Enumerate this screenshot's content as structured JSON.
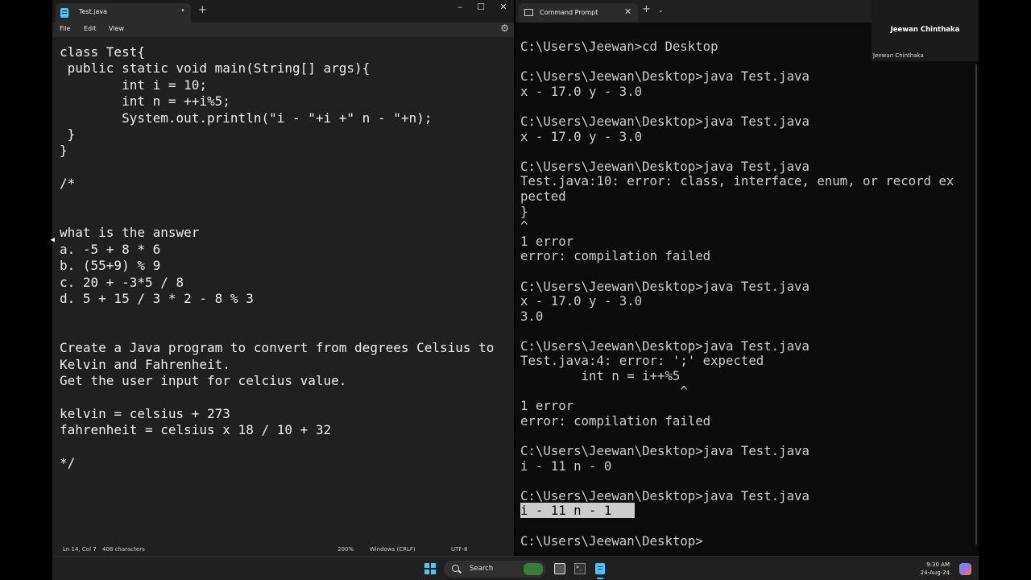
{
  "notepad": {
    "tab_title": "Test.java",
    "tab_dot": "•",
    "new_tab": "+",
    "window_controls": {
      "minimize": "–",
      "maximize": "☐",
      "close": "✕"
    },
    "menu": [
      "File",
      "Edit",
      "View"
    ],
    "settings_icon": "⚙",
    "editor_text": "class Test{\n public static void main(String[] args){\n        int i = 10;\n        int n = ++i%5;\n        System.out.println(\"i - \"+i +\" n - \"+n);\n }\n}\n\n/*\n\n\nwhat is the answer\na. -5 + 8 * 6\nb. (55+9) % 9\nc. 20 + -3*5 / 8\nd. 5 + 15 / 3 * 2 - 8 % 3\n\n\nCreate a Java program to convert from degrees Celsius to\nKelvin and Fahrenheit.\nGet the user input for celcius value.\n\nkelvin = celsius + 273\nfahrenheit = celsius x 18 / 10 + 32\n\n*/",
    "status": {
      "position": "Ln 14, Col 7",
      "characters": "408 characters",
      "zoom": "200%",
      "line_ending": "Windows (CRLF)",
      "encoding": "UTF-8"
    }
  },
  "cmd": {
    "tab_title": "Command Prompt",
    "close": "✕",
    "new_tab": "+",
    "dropdown": "⌄",
    "output_before_selection": "C:\\Users\\Jeewan>cd Desktop\n\nC:\\Users\\Jeewan\\Desktop>java Test.java\nx - 17.0 y - 3.0\n\nC:\\Users\\Jeewan\\Desktop>java Test.java\nx - 17.0 y - 3.0\n\nC:\\Users\\Jeewan\\Desktop>java Test.java\nTest.java:10: error: class, interface, enum, or record ex\npected\n}\n^\n1 error\nerror: compilation failed\n\nC:\\Users\\Jeewan\\Desktop>java Test.java\nx - 17.0 y - 3.0\n3.0\n\nC:\\Users\\Jeewan\\Desktop>java Test.java\nTest.java:4: error: ';' expected\n        int n = i++%5\n                     ^\n1 error\nerror: compilation failed\n\nC:\\Users\\Jeewan\\Desktop>java Test.java\ni - 11 n - 0\n\nC:\\Users\\Jeewan\\Desktop>java Test.java\n",
    "selected_text": "i - 11 n - 1   ",
    "output_after_selection": "\n\nC:\\Users\\Jeewan\\Desktop>"
  },
  "participant": {
    "name": "Jeewan Chinthaka",
    "label": "Jeewan Chinthaka"
  },
  "taskbar": {
    "search_label": "Search",
    "time": "9:30 AM",
    "date": "24-Aug-24",
    "accent": "#4cc2ff"
  }
}
